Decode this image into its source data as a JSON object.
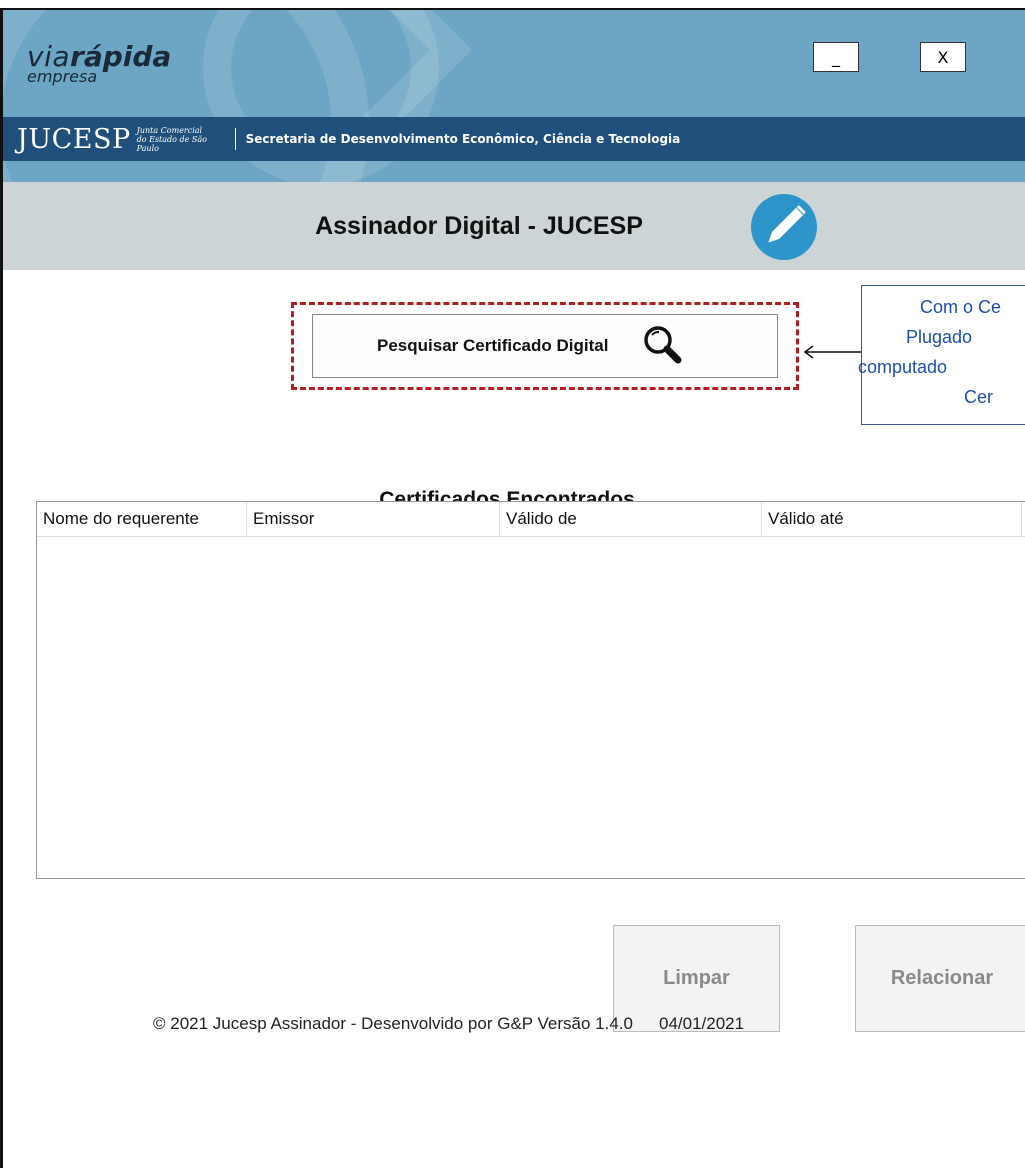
{
  "header": {
    "logo_via": "via",
    "logo_rapida": "rápida",
    "logo_empresa": "empresa",
    "minimize_label": "_",
    "close_label": "X",
    "org_name": "JUCESP",
    "org_subtitle_1": "Junta Comercial",
    "org_subtitle_2": "do Estado de São Paulo",
    "secretaria": "Secretaria de Desenvolvimento Econômico, Ciência e Tecnologia"
  },
  "title": {
    "text": "Assinador Digital - JUCESP"
  },
  "search": {
    "button_label": "Pesquisar Certificado Digital"
  },
  "callout": {
    "lines": [
      "Com o Ce",
      "Plugado",
      "computado",
      "Cer"
    ]
  },
  "certificates": {
    "title": "Certificados Encontrados",
    "columns": [
      "Nome do requerente",
      "Emissor",
      "Válido de",
      "Válido até"
    ],
    "rows": []
  },
  "actions": {
    "clear_label": "Limpar",
    "relate_label": "Relacionar"
  },
  "footer": {
    "credits": "© 2021 Jucesp Assinador - Desenvolvido por G&P Versão  1.4.0",
    "date": "04/01/2021"
  },
  "colors": {
    "header_bg": "#6da5c4",
    "jucesp_bar": "#1f4f7a",
    "title_bar": "#cdd4d6",
    "pencil_icon": "#2d95c9",
    "highlight_dashed": "#b01d22",
    "callout_text": "#1f4fa8"
  },
  "icons": {
    "edit": "pencil-icon",
    "search": "magnifier-icon",
    "arrow": "arrow-left-icon"
  }
}
